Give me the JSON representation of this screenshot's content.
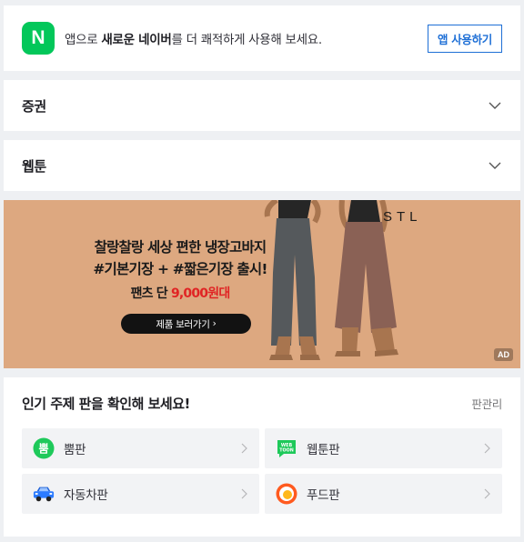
{
  "app_banner": {
    "logo_letter": "N",
    "text_prefix": "앱으로 ",
    "text_bold": "새로운 네이버",
    "text_suffix": "를 더 쾌적하게 사용해 보세요.",
    "button_label": "앱 사용하기"
  },
  "sections": [
    {
      "title": "증권"
    },
    {
      "title": "웹툰"
    }
  ],
  "ad": {
    "line1": "찰랑찰랑 세상 편한 냉장고바지",
    "line2": "#기본기장 + #짧은기장 출시!",
    "line3_prefix": "팬츠 단 ",
    "line3_highlight": "9,000원대",
    "cta_label": "제품 보러가기",
    "cta_arrow": "›",
    "brand_logo": "STL",
    "badge": "AD",
    "colors": {
      "background": "#dda880",
      "highlight": "#e02424"
    }
  },
  "topic_panel": {
    "title": "인기 주제 판을 확인해 보세요!",
    "manage_label": "판관리",
    "items": [
      {
        "label": "뿜판",
        "icon": "bbom-icon",
        "icon_text": "뿜"
      },
      {
        "label": "웹툰판",
        "icon": "webtoon-icon",
        "icon_text": "WEB TOON"
      },
      {
        "label": "자동차판",
        "icon": "car-icon"
      },
      {
        "label": "푸드판",
        "icon": "food-icon"
      }
    ]
  }
}
